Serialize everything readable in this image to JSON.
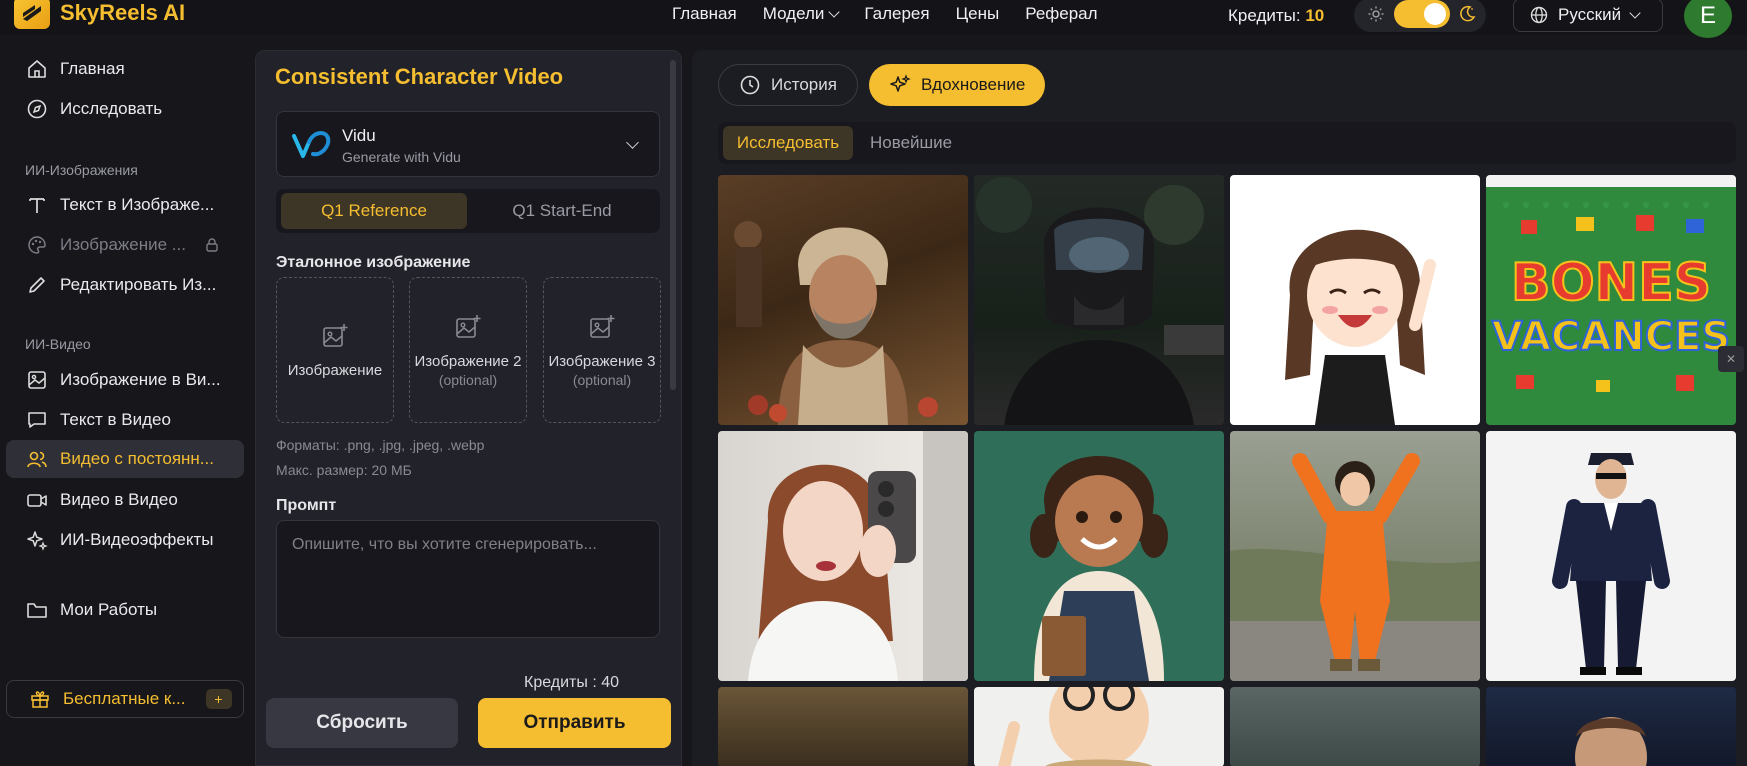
{
  "brand": {
    "name": "SkyReels AI"
  },
  "nav": {
    "items": [
      "Главная",
      "Модели",
      "Галерея",
      "Цены",
      "Реферал"
    ],
    "credits_label": "Кредиты:",
    "credits_value": "10",
    "language": "Русский",
    "avatar_letter": "E"
  },
  "sidebar": {
    "home": "Главная",
    "explore": "Исследовать",
    "section_image": "ИИ-Изображения",
    "text_to_image": "Текст в Изображе...",
    "image_locked": "Изображение ...",
    "edit_image": "Редактировать Из...",
    "section_video": "ИИ-Видео",
    "image_to_video": "Изображение в Ви...",
    "text_to_video": "Текст в Видео",
    "consistent_video": "Видео с постоянн...",
    "video_to_video": "Видео в Видео",
    "video_effects": "ИИ-Видеоэффекты",
    "my_works": "Мои Работы",
    "free_credits": "Бесплатные к...",
    "free_plus": "+"
  },
  "panel": {
    "title": "Consistent Character Video",
    "model_name": "Vidu",
    "model_sub": "Generate with Vidu",
    "mode_active": "Q1 Reference",
    "mode_inactive": "Q1 Start-End",
    "ref_label": "Эталонное изображение",
    "upload1": "Изображение",
    "upload2": "Изображение 2",
    "upload3": "Изображение 3",
    "optional": "(optional)",
    "formats": "Форматы: .png, .jpg, .jpeg, .webp",
    "max_size": "Макс. размер: 20 МБ",
    "prompt_label": "Промпт",
    "prompt_placeholder": "Опишите, что вы хотите сгенерировать...",
    "credits_cost": "Кредиты : 40",
    "reset": "Сбросить",
    "send": "Отправить"
  },
  "gallery": {
    "tab_history": "История",
    "tab_inspiration": "Вдохновение",
    "sub_explore": "Исследовать",
    "sub_newest": "Новейшие",
    "lego_text_1": "BONES",
    "lego_text_2": "VACANCES"
  },
  "colors": {
    "accent": "#f5bd30",
    "bg": "#16161b",
    "panel": "#22222a"
  }
}
